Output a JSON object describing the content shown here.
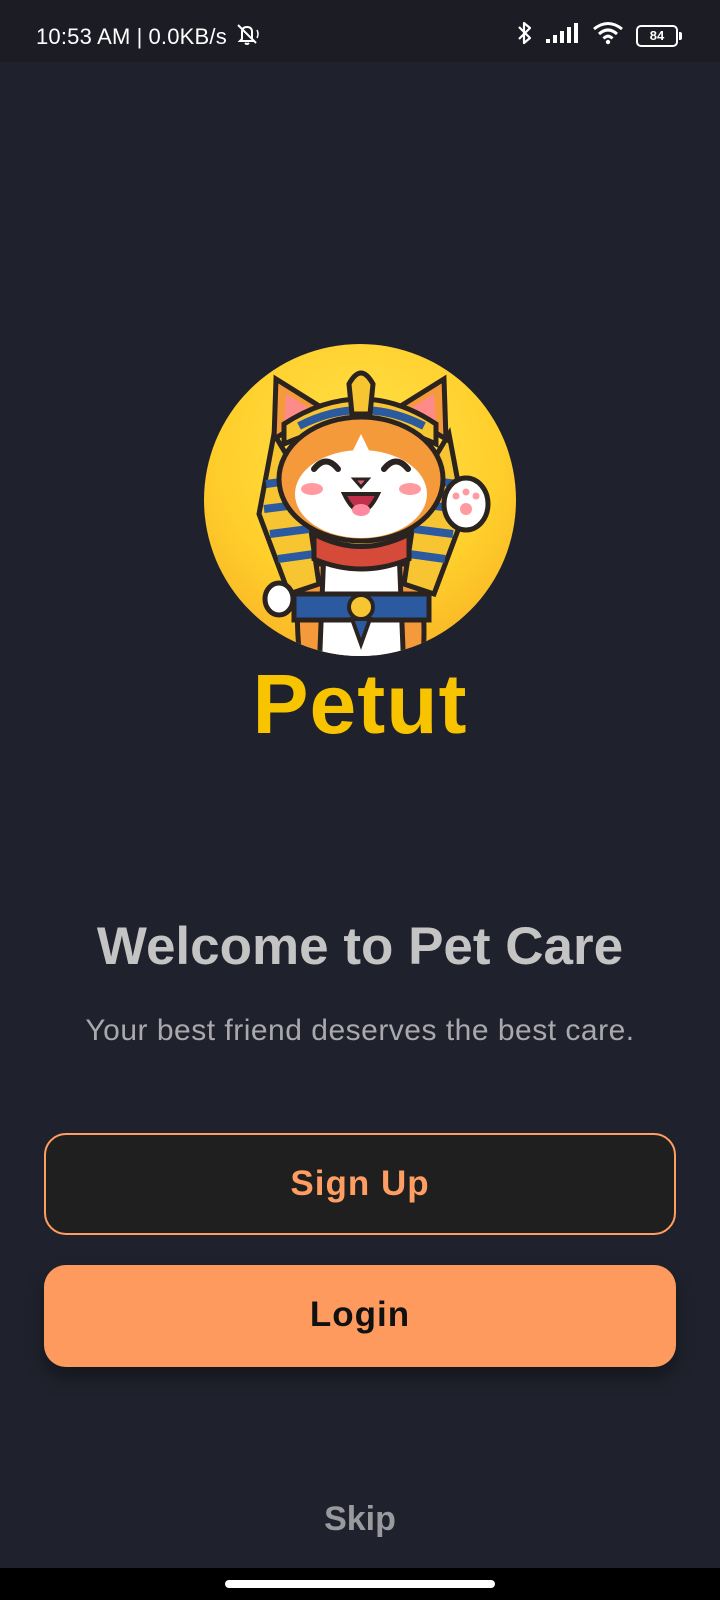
{
  "status_bar": {
    "time": "10:53 AM",
    "separator": "|",
    "network_speed": "0.0KB/s",
    "battery_level": "84",
    "icons": [
      "silent-icon",
      "bluetooth-icon",
      "signal-icon",
      "wifi-icon",
      "battery-icon"
    ]
  },
  "logo": {
    "brand_name": "Petut",
    "mascot": "pharaoh-cat-mascot",
    "circle_color": "#ffcf2b"
  },
  "welcome": {
    "title": "Welcome to Pet Care",
    "subtitle": "Your best friend deserves the best care."
  },
  "actions": {
    "signup_label": "Sign Up",
    "login_label": "Login",
    "skip_label": "Skip"
  },
  "colors": {
    "background": "#1f212c",
    "accent": "#ff9a5e",
    "brand_yellow": "#f8c400"
  }
}
